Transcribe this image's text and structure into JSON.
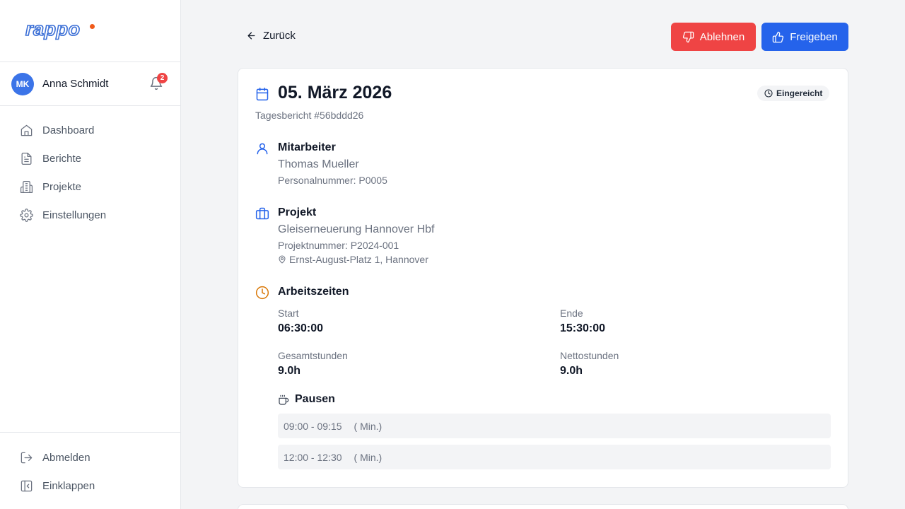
{
  "brand": {
    "logo_text": "rappo",
    "accent": "#f05a1a",
    "primary": "#3b6fd6"
  },
  "user": {
    "initials": "MK",
    "name": "Anna Schmidt",
    "notifications": "2"
  },
  "nav": [
    {
      "label": "Dashboard",
      "icon": "home-icon"
    },
    {
      "label": "Berichte",
      "icon": "document-icon"
    },
    {
      "label": "Projekte",
      "icon": "building-icon"
    },
    {
      "label": "Einstellungen",
      "icon": "gear-icon"
    }
  ],
  "bottom_nav": [
    {
      "label": "Abmelden",
      "icon": "logout-icon"
    },
    {
      "label": "Einklappen",
      "icon": "collapse-icon"
    }
  ],
  "toolbar": {
    "back_label": "Zurück",
    "reject_label": "Ablehnen",
    "approve_label": "Freigeben",
    "reject_color": "#ef4444",
    "approve_color": "#2563eb"
  },
  "report": {
    "date": "05. März 2026",
    "subtitle": "Tagesbericht #56bddd26",
    "status": "Eingereicht",
    "employee": {
      "section": "Mitarbeiter",
      "name": "Thomas Mueller",
      "id_line": "Personalnummer: P0005"
    },
    "project": {
      "section": "Projekt",
      "name": "Gleiserneuerung Hannover Hbf",
      "number_line": "Projektnummer: P2024-001",
      "address": "Ernst-August-Platz 1, Hannover"
    },
    "times": {
      "section": "Arbeitszeiten",
      "start_label": "Start",
      "start": "06:30:00",
      "end_label": "Ende",
      "end": "15:30:00",
      "total_label": "Gesamtstunden",
      "total": "9.0h",
      "net_label": "Nettostunden",
      "net": "9.0h"
    },
    "pauses": {
      "section": "Pausen",
      "items": [
        {
          "range": "09:00 - 09:15",
          "duration": "( Min.)"
        },
        {
          "range": "12:00 - 12:30",
          "duration": "( Min.)"
        }
      ]
    }
  }
}
